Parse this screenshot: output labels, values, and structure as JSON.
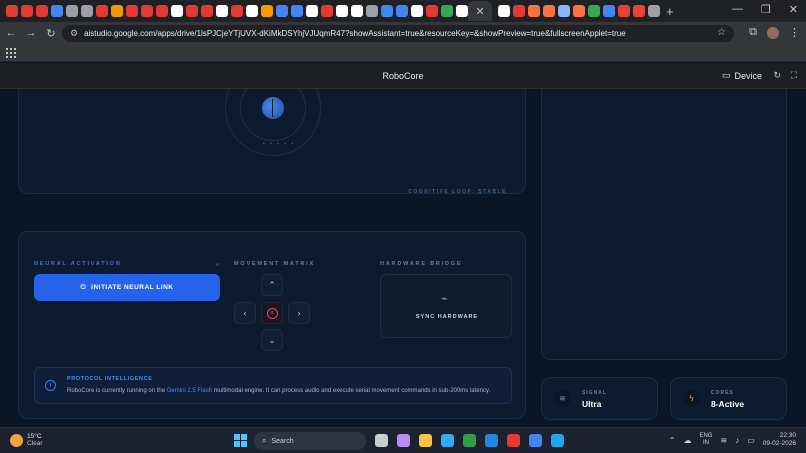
{
  "browser": {
    "url": "aistudio.google.com/apps/drive/1lsPJCjeYTjUVX-dKiMkDSYhjVJUqmR47?showAssistant=true&resourceKey=&showPreview=true&fullscreenApplet=true",
    "active_tab_close": "✕",
    "new_tab": "+",
    "window_controls": [
      "—",
      "❐",
      "✕"
    ],
    "tab_favicon_colors": [
      "#e53935",
      "#e53935",
      "#e53935",
      "#4285f4",
      "#9aa0a6",
      "#9aa0a6",
      "#e53935",
      "#f29900",
      "#e53935",
      "#e53935",
      "#e53935",
      "#ffffff",
      "#e53935",
      "#e53935",
      "#ffffff",
      "#e53935",
      "#ffffff",
      "#ff9800",
      "#4285f4",
      "#4285f4",
      "#ffffff",
      "#e53935",
      "#ffffff",
      "#ffffff",
      "#9aa0a6",
      "#4285f4",
      "#4285f4",
      "#ffffff",
      "#e53935",
      "#34a853",
      "#ffffff"
    ],
    "right_favicon_colors": [
      "#ffffff",
      "#e53935",
      "#ff7043",
      "#ff7043",
      "#8ab4f8",
      "#ff7043",
      "#34a853",
      "#4285f4",
      "#ea4335",
      "#ea4335",
      "#9aa0a6"
    ]
  },
  "app": {
    "title": "RoboCore",
    "device_label": "Device"
  },
  "visualizer": {
    "dots": "• • • • •",
    "status": "COGNITIVE LOOP: STABLE"
  },
  "controls": {
    "neural_label": "NEURAL ACTIVATION",
    "neural_button": "INITIATE NEURAL LINK",
    "movement_label": "MOVEMENT MATRIX",
    "hardware_label": "HARDWARE BRIDGE",
    "hardware_button": "SYNC HARDWARE",
    "pad": {
      "up": "⌃",
      "left": "‹",
      "right": "›",
      "down": "⌄",
      "stop": "×"
    }
  },
  "protocol": {
    "title": "PROTOCOL INTELLIGENCE",
    "text_before": "RoboCore is currently running on the ",
    "highlight": "Gemini 2.5 Flash",
    "text_after": " multimodal engine. It can process audio and execute serial movement commands in sub-200ms latency."
  },
  "stats": {
    "signal": {
      "label": "SIGNAL",
      "value": "Ultra",
      "icon": "wifi-icon"
    },
    "cores": {
      "label": "CORES",
      "value": "8-Active",
      "icon": "bolt-icon"
    }
  },
  "taskbar": {
    "temperature": "15°C",
    "weather": "Clear",
    "search": "Search",
    "lang_top": "ENG",
    "lang_bottom": "IN",
    "time": "22:30",
    "date": "09-02-2026",
    "app_colors": [
      "#c7cbd2",
      "#b48ef0",
      "#f5c542",
      "#34a8ff",
      "#2f9e44",
      "#1f88e5",
      "#e53935",
      "#4285f4",
      "#22a6f0"
    ]
  },
  "colors": {
    "accent": "#2563eb",
    "stop": "#e54b5a",
    "background": "#0a1628"
  }
}
